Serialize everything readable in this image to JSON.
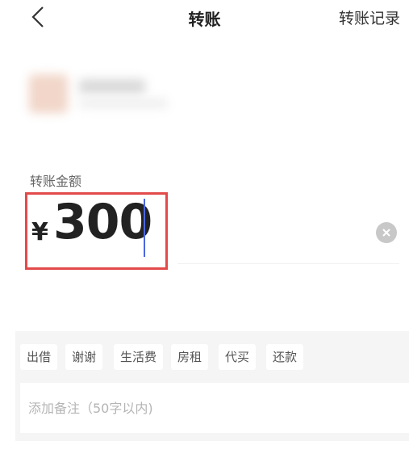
{
  "header": {
    "title": "转账",
    "history_label": "转账记录"
  },
  "amount": {
    "label": "转账金额",
    "currency_symbol": "¥",
    "value": "300"
  },
  "chips": [
    "出借",
    "谢谢",
    "生活费",
    "房租",
    "代买",
    "还款"
  ],
  "note": {
    "placeholder": "添加备注（50字以内)"
  },
  "colors": {
    "highlight": "#e34a4a",
    "caret": "#4a68e0"
  }
}
